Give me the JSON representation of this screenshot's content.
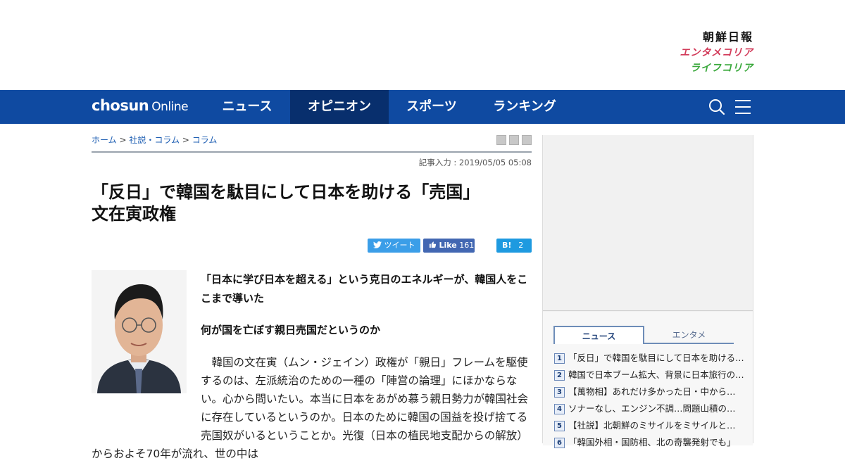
{
  "brand": {
    "chosun_logo": "朝鮮日報",
    "entame_logo": "エンタメコリア",
    "life_logo": "ライフコリア"
  },
  "nav": {
    "logo": "chosun",
    "logo_suffix": "Online",
    "items": [
      "ニュース",
      "オピニオン",
      "スポーツ",
      "ランキング"
    ],
    "active": "オピニオン",
    "colors": {
      "bar": "#0f4aa1",
      "active": "#082f6d"
    }
  },
  "breadcrumb": [
    "ホーム",
    "社説・コラム",
    "コラム"
  ],
  "article": {
    "dateline": "記事入力 : 2019/05/05 05:08",
    "headline_line1": "「反日」で韓国を駄目にして日本を助ける「売国」",
    "headline_line2": "文在寅政権",
    "share": {
      "tweet": "ツイート",
      "like_label": "Like",
      "like_count": "161",
      "hatena_label": "B!",
      "hatena_count": "2"
    },
    "subhead1": "「日本に学び日本を超える」という克日のエネルギーが、韓国人をここまで導いた",
    "subhead2": "何が国を亡ぼす親日売国だというのか",
    "body": "　韓国の文在寅（ムン・ジェイン）政権が「親日」フレームを駆使するのは、左派統治のための一種の「陣営の論理」にほかならない。心から問いたい。本当に日本をあがめ慕う親日勢力が韓国社会に存在しているというのか。日本のために韓国の国益を投げ捨てる売国奴がいるということか。光復（日本の植民地支配からの解放）からおよそ70年が流れ、世の中は"
  },
  "sidebar": {
    "tabs": [
      "ニュース",
      "エンタメ"
    ],
    "active_tab": "ニュース",
    "ranking": [
      {
        "num": "1",
        "title": "「反日」で韓国を駄目にして日本を助ける「売国」文在寅政権"
      },
      {
        "num": "2",
        "title": "韓国で日本ブーム拡大、背景に日本旅行の大衆化"
      },
      {
        "num": "3",
        "title": "【萬物相】あれだけ多かった日・中からの観光客は"
      },
      {
        "num": "4",
        "title": "ソナーなし、エンジン不調…問題山積の潜水艦"
      },
      {
        "num": "5",
        "title": "【社説】北朝鮮のミサイルをミサイルと言えない政府"
      },
      {
        "num": "6",
        "title": "「韓国外相・国防相、北の奇襲発射でも」"
      }
    ]
  }
}
